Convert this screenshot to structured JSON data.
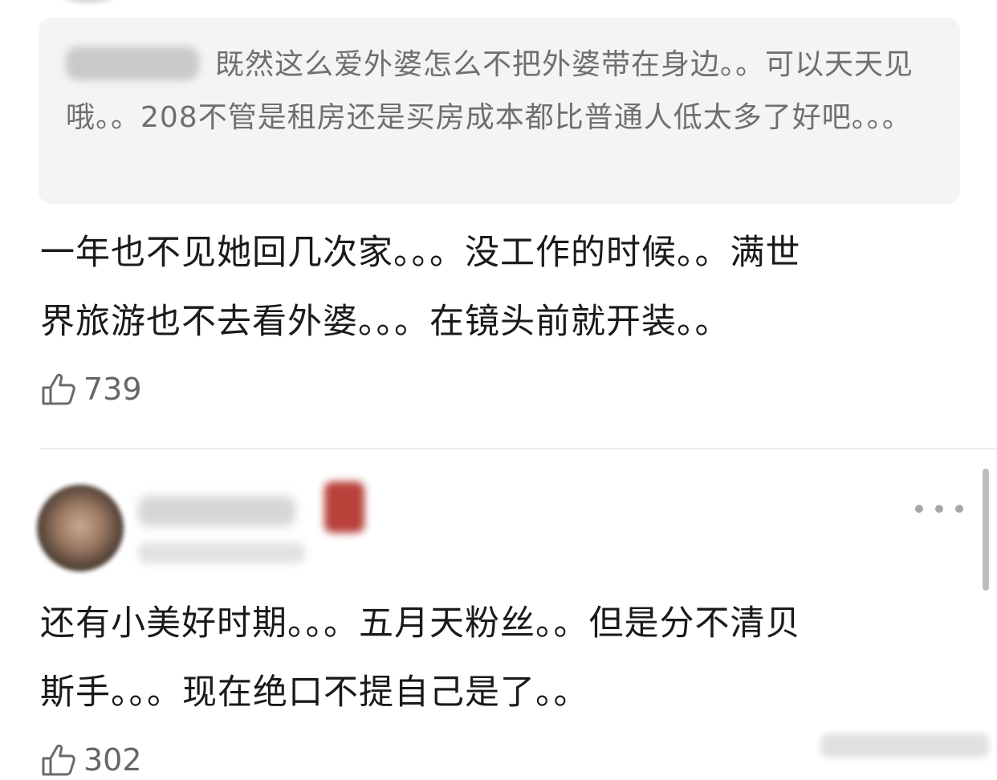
{
  "reply_quote": {
    "text": "既然这么爱外婆怎么不把外婆带在身边。。可以天天见哦。。208不管是租房还是买房成本都比普通人低太多了好吧。。。"
  },
  "comments": [
    {
      "text_lines": [
        "一年也不见她回几次家。。。没工作的时候。。满世",
        "界旅游也不去看外婆。。。在镜头前就开装。。"
      ],
      "likes": "739"
    },
    {
      "text_lines": [
        "还有小美好时期。。。五月天粉丝。。但是分不清贝",
        "斯手。。。现在绝口不提自己是了。。"
      ],
      "likes": "302"
    }
  ],
  "icons": {
    "like": "thumbs-up-icon",
    "more": "more-dots-icon"
  },
  "colors": {
    "quote_background": "#f4f4f4",
    "quote_text": "#6f6f6f",
    "body_text": "#1a1a1a",
    "meta_text": "#666666"
  }
}
